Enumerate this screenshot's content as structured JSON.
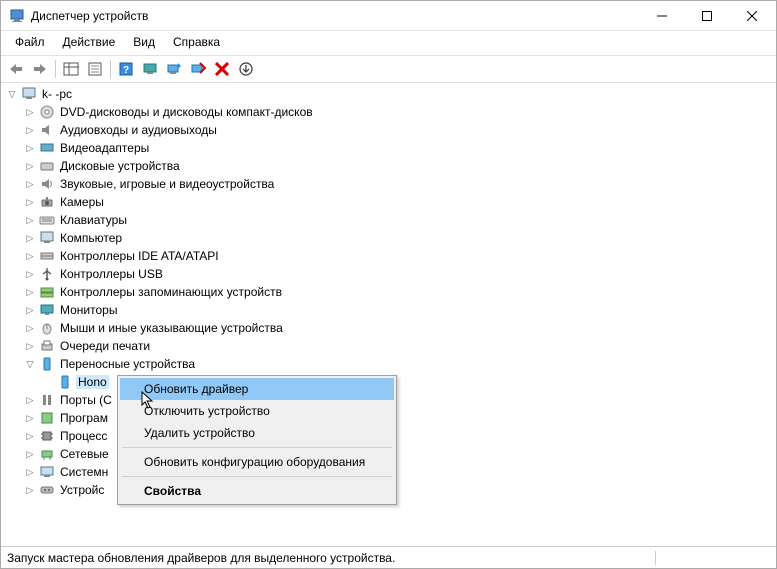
{
  "window": {
    "title": "Диспетчер устройств"
  },
  "menu": {
    "file": "Файл",
    "action": "Действие",
    "view": "Вид",
    "help": "Справка"
  },
  "tree": {
    "root": "k-           -pc",
    "items": [
      "DVD-дисководы и дисководы компакт-дисков",
      "Аудиовходы и аудиовыходы",
      "Видеоадаптеры",
      "Дисковые устройства",
      "Звуковые, игровые и видеоустройства",
      "Камеры",
      "Клавиатуры",
      "Компьютер",
      "Контроллеры IDE ATA/ATAPI",
      "Контроллеры USB",
      "Контроллеры запоминающих устройств",
      "Мониторы",
      "Мыши и иные указывающие устройства",
      "Очереди печати",
      "Переносные устройства",
      "Порты (C",
      "Програм",
      "Процесс",
      "Сетевые",
      "Системн",
      "Устройс"
    ],
    "portable_child": "Hono"
  },
  "context_menu": {
    "update_driver": "Обновить драйвер",
    "disable_device": "Отключить устройство",
    "remove_device": "Удалить устройство",
    "refresh_hw": "Обновить конфигурацию оборудования",
    "properties": "Свойства"
  },
  "status": "Запуск мастера обновления драйверов для выделенного устройства."
}
